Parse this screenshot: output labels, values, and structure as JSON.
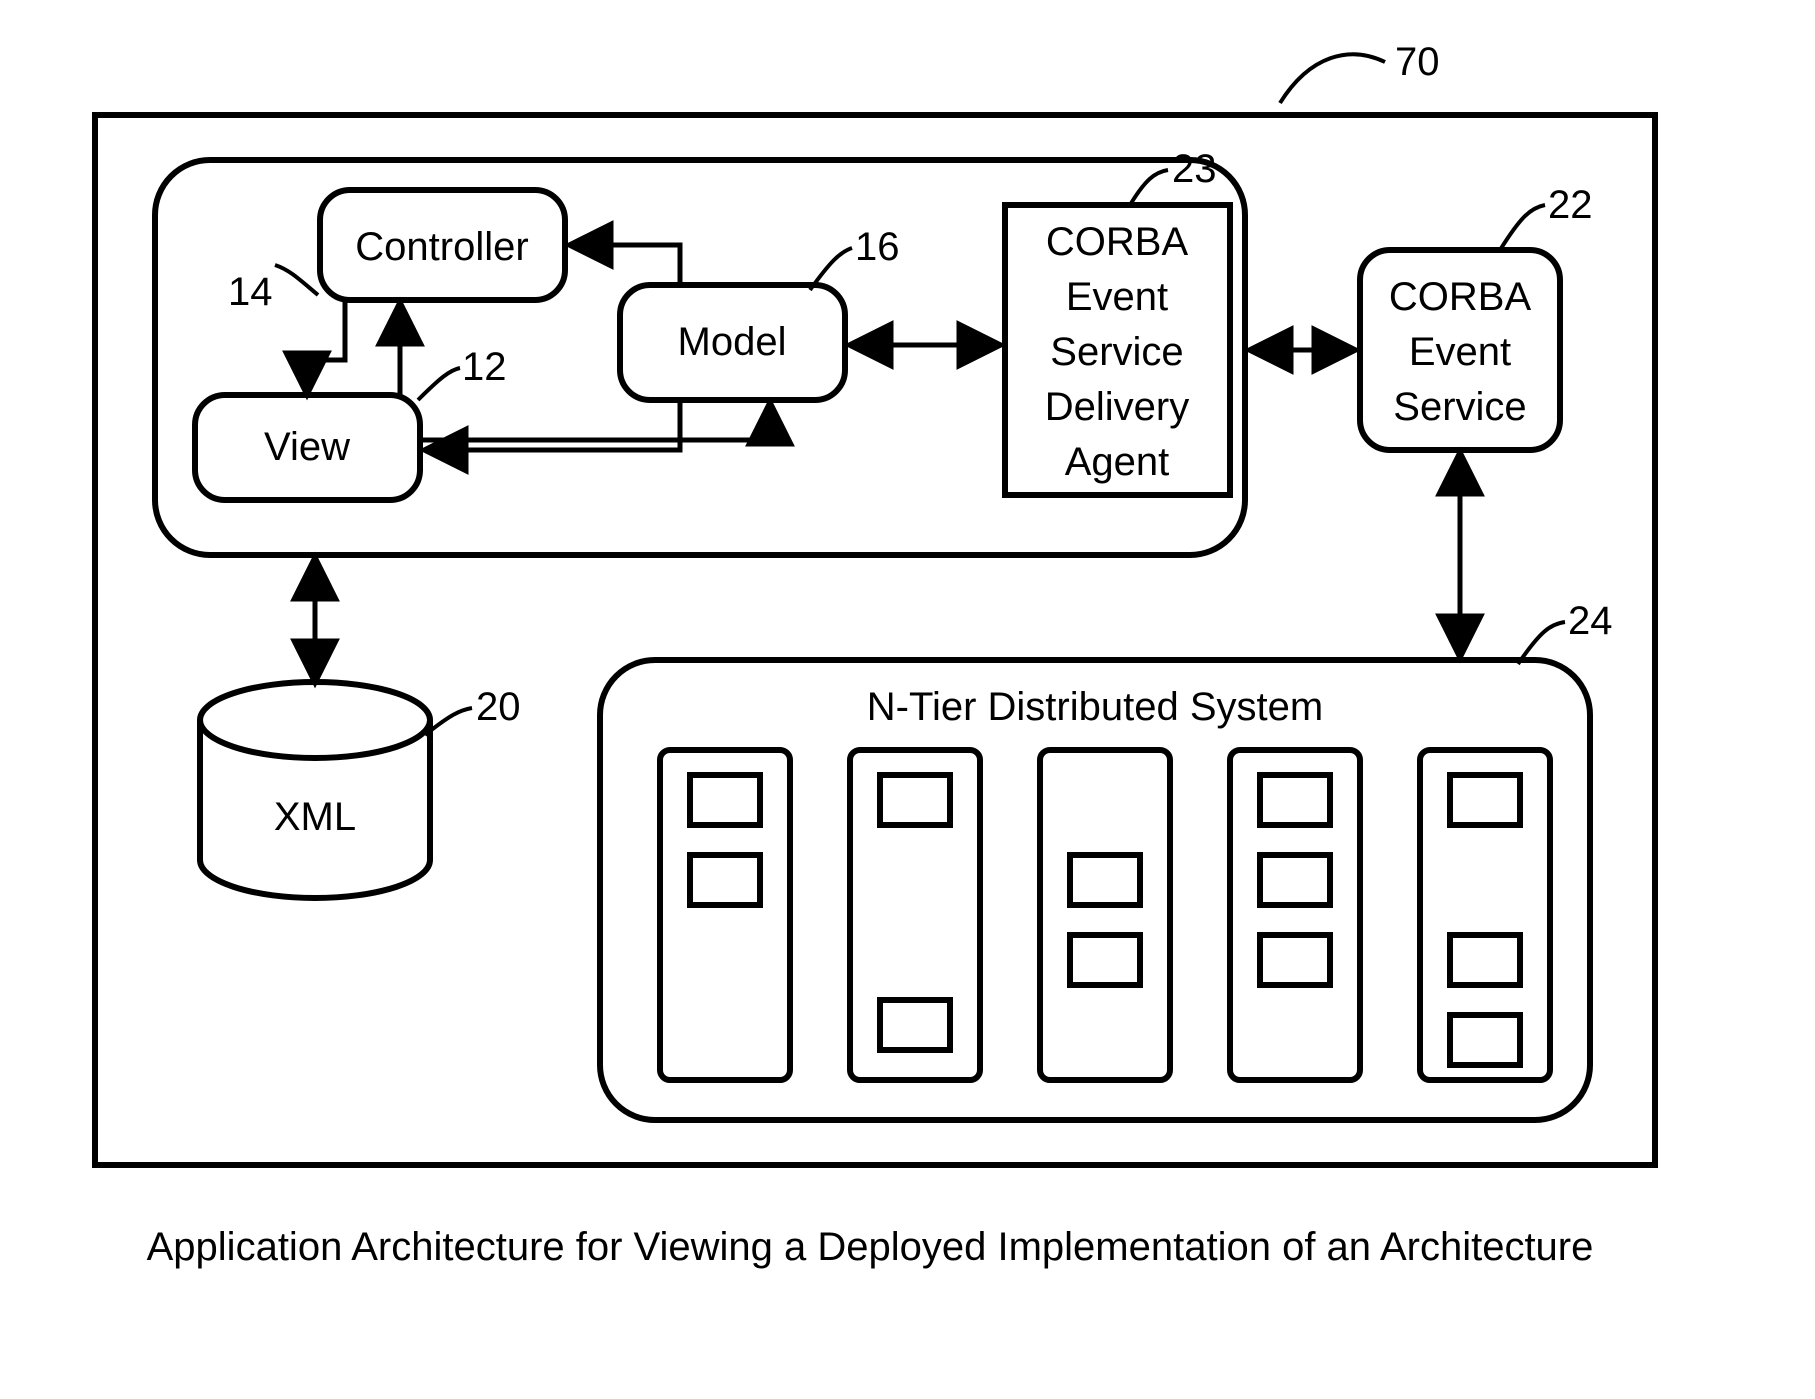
{
  "refs": {
    "outer": "70",
    "controller": "14",
    "view": "12",
    "model": "16",
    "agent": "23",
    "event_service": "22",
    "xml": "20",
    "ntier": "24"
  },
  "labels": {
    "controller": "Controller",
    "view": "View",
    "model": "Model",
    "agent_l1": "CORBA",
    "agent_l2": "Event",
    "agent_l3": "Service",
    "agent_l4": "Delivery",
    "agent_l5": "Agent",
    "event_service_l1": "CORBA",
    "event_service_l2": "Event",
    "event_service_l3": "Service",
    "xml": "XML",
    "ntier_title": "N-Tier Distributed System"
  },
  "caption": "Application Architecture for Viewing a Deployed Implementation of an Architecture"
}
